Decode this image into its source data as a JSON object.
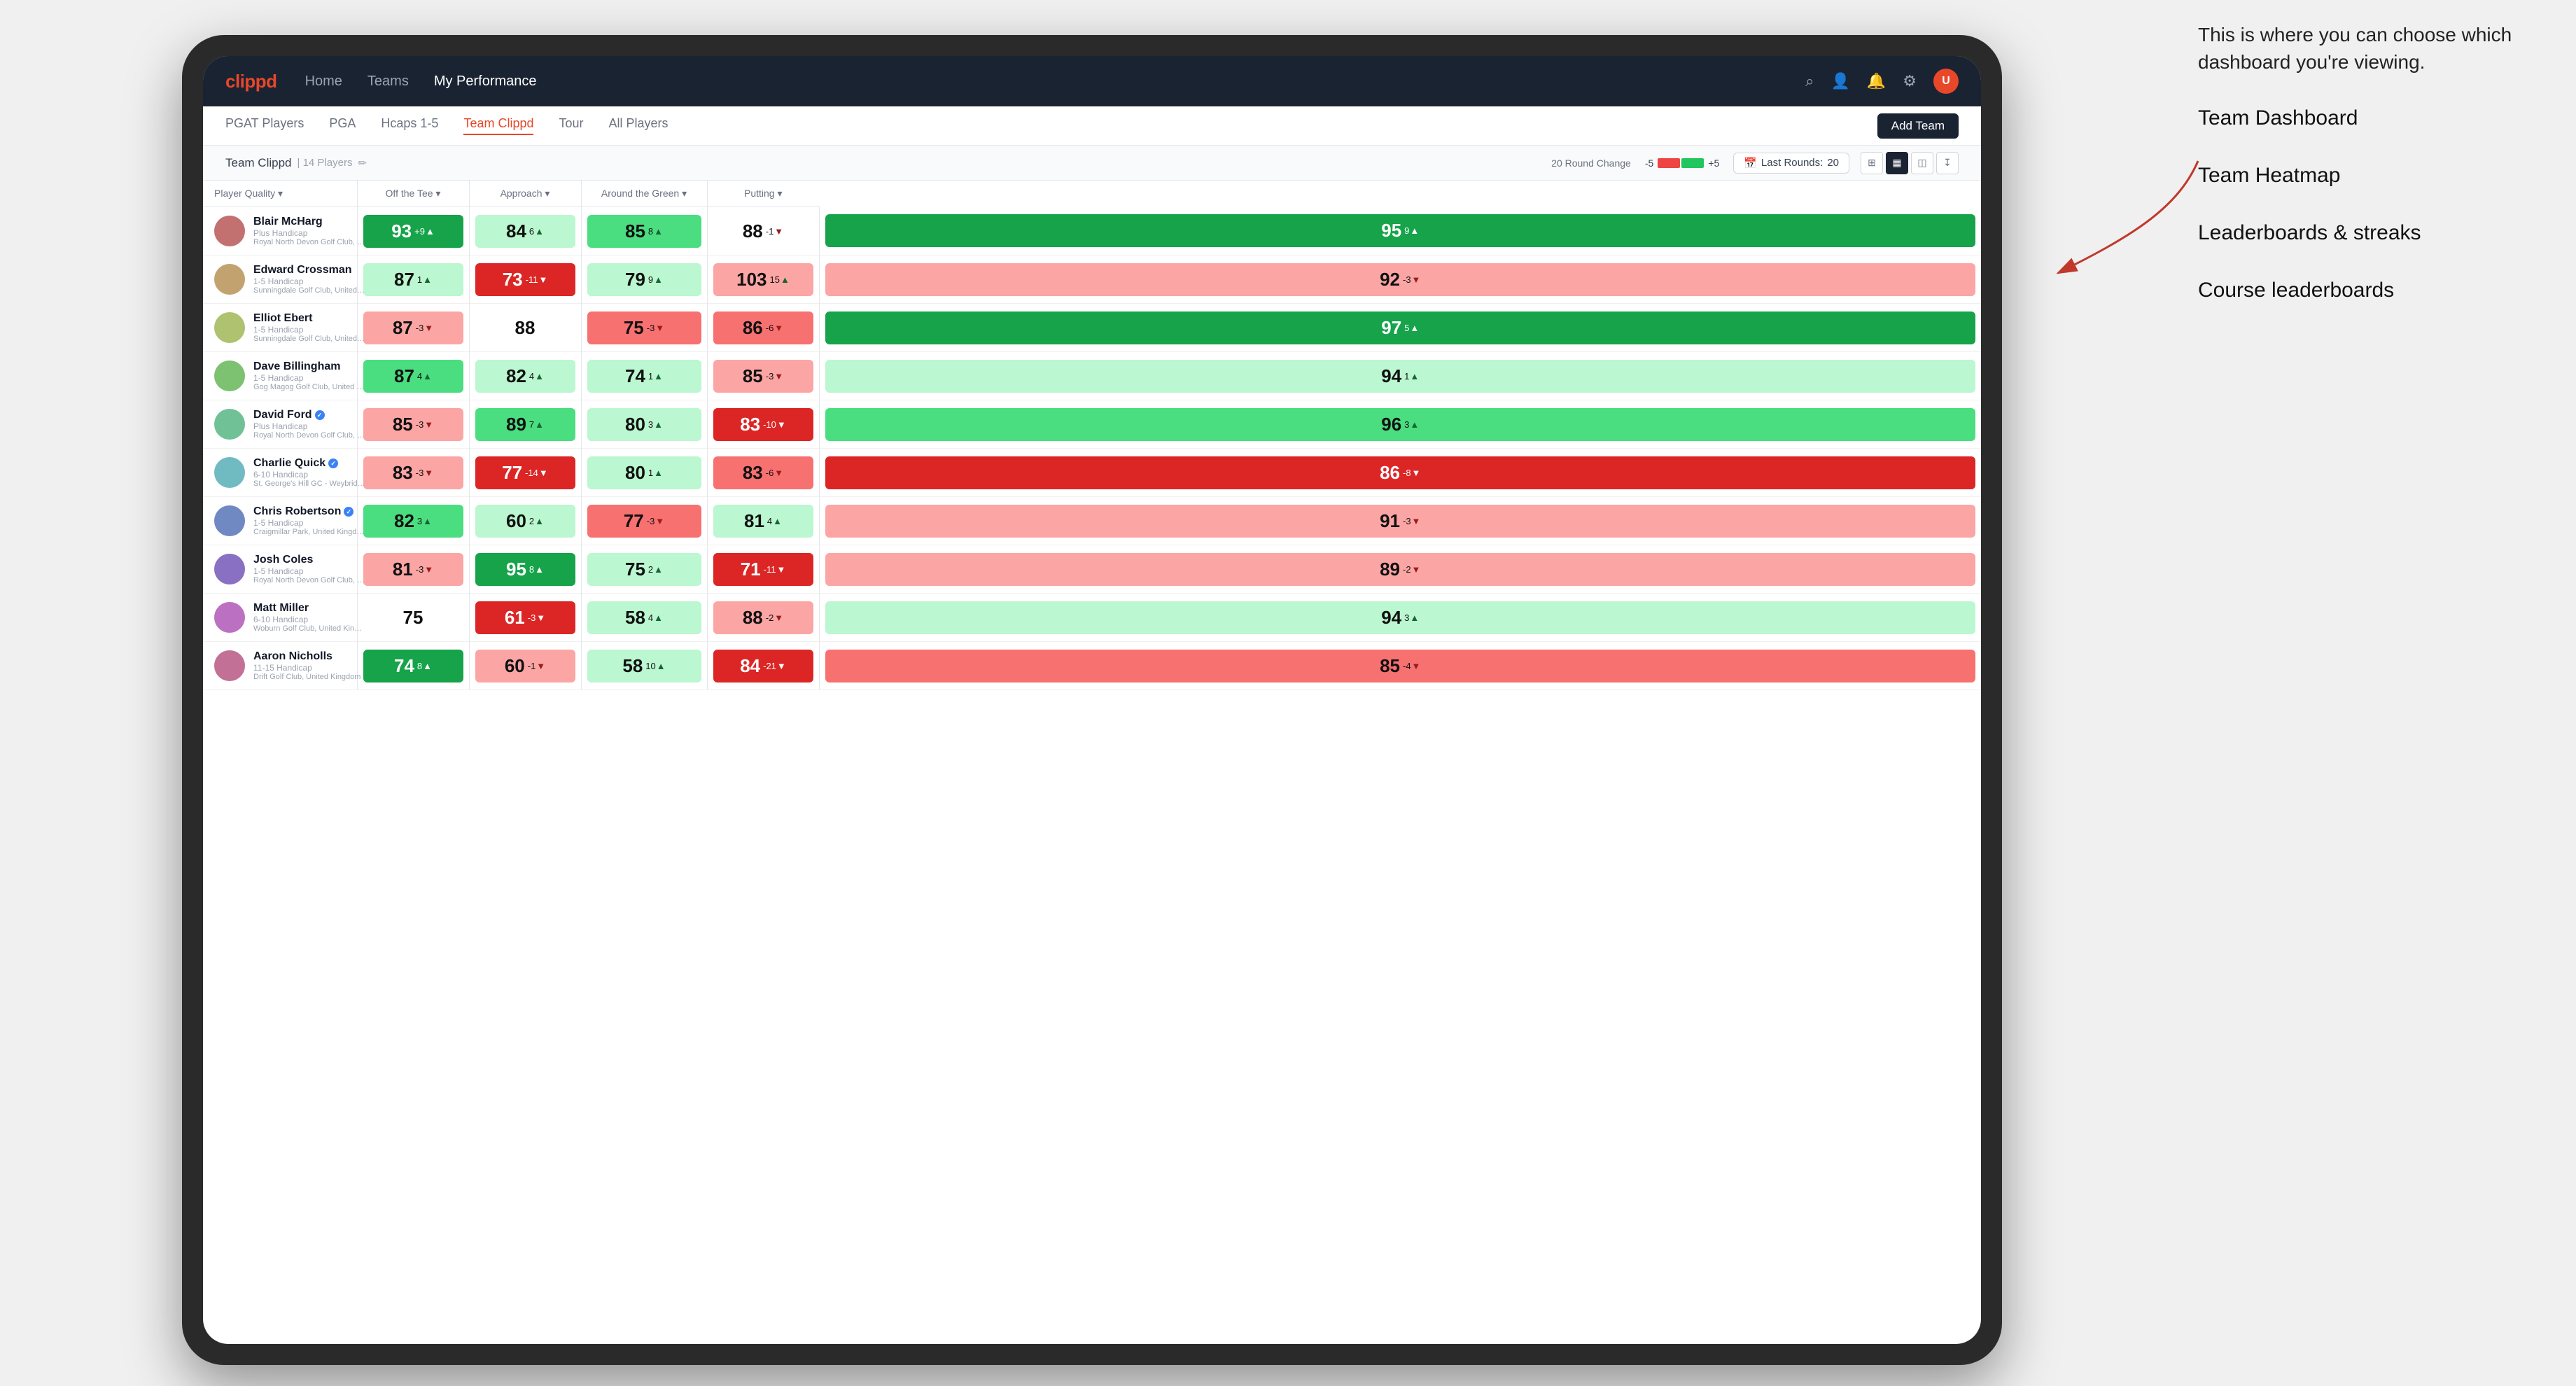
{
  "annotation": {
    "intro": "This is where you can choose which dashboard you're viewing.",
    "items": [
      "Team Dashboard",
      "Team Heatmap",
      "Leaderboards & streaks",
      "Course leaderboards"
    ]
  },
  "nav": {
    "logo": "clippd",
    "links": [
      {
        "label": "Home",
        "active": false
      },
      {
        "label": "Teams",
        "active": false
      },
      {
        "label": "My Performance",
        "active": true
      }
    ],
    "icons": [
      "search",
      "person",
      "bell",
      "settings",
      "avatar"
    ]
  },
  "subnav": {
    "links": [
      {
        "label": "PGAT Players",
        "active": false
      },
      {
        "label": "PGA",
        "active": false
      },
      {
        "label": "Hcaps 1-5",
        "active": false
      },
      {
        "label": "Team Clippd",
        "active": true
      },
      {
        "label": "Tour",
        "active": false
      },
      {
        "label": "All Players",
        "active": false
      }
    ],
    "add_team_label": "Add Team"
  },
  "team_bar": {
    "name": "Team Clippd",
    "separator": "|",
    "count": "14 Players",
    "round_change_label": "20 Round Change",
    "bar_neg": "-5",
    "bar_pos": "+5",
    "last_rounds_label": "Last Rounds:",
    "last_rounds_value": "20",
    "view_options": [
      "grid",
      "table",
      "chart",
      "export"
    ]
  },
  "table": {
    "headers": [
      {
        "label": "Player Quality",
        "sort": true
      },
      {
        "label": "Off the Tee",
        "sort": true
      },
      {
        "label": "Approach",
        "sort": true
      },
      {
        "label": "Around the Green",
        "sort": true
      },
      {
        "label": "Putting",
        "sort": true
      }
    ],
    "players": [
      {
        "name": "Blair McHarg",
        "handicap": "Plus Handicap",
        "club": "Royal North Devon Golf Club, United Kingdom",
        "scores": [
          {
            "value": 93,
            "change": "+9",
            "dir": "up",
            "bg": "green-strong"
          },
          {
            "value": 84,
            "change": "6",
            "dir": "up",
            "bg": "green-light"
          },
          {
            "value": 85,
            "change": "8",
            "dir": "up",
            "bg": "green-medium"
          },
          {
            "value": 88,
            "change": "-1",
            "dir": "down",
            "bg": "white"
          },
          {
            "value": 95,
            "change": "9",
            "dir": "up",
            "bg": "green-strong"
          }
        ]
      },
      {
        "name": "Edward Crossman",
        "handicap": "1-5 Handicap",
        "club": "Sunningdale Golf Club, United Kingdom",
        "scores": [
          {
            "value": 87,
            "change": "1",
            "dir": "up",
            "bg": "green-light"
          },
          {
            "value": 73,
            "change": "-11",
            "dir": "down",
            "bg": "red-strong"
          },
          {
            "value": 79,
            "change": "9",
            "dir": "up",
            "bg": "green-light"
          },
          {
            "value": 103,
            "change": "15",
            "dir": "up",
            "bg": "red-light"
          },
          {
            "value": 92,
            "change": "-3",
            "dir": "down",
            "bg": "red-light"
          }
        ]
      },
      {
        "name": "Elliot Ebert",
        "handicap": "1-5 Handicap",
        "club": "Sunningdale Golf Club, United Kingdom",
        "scores": [
          {
            "value": 87,
            "change": "-3",
            "dir": "down",
            "bg": "red-light"
          },
          {
            "value": 88,
            "change": "",
            "dir": "",
            "bg": "white"
          },
          {
            "value": 75,
            "change": "-3",
            "dir": "down",
            "bg": "red-medium"
          },
          {
            "value": 86,
            "change": "-6",
            "dir": "down",
            "bg": "red-medium"
          },
          {
            "value": 97,
            "change": "5",
            "dir": "up",
            "bg": "green-strong"
          }
        ]
      },
      {
        "name": "Dave Billingham",
        "handicap": "1-5 Handicap",
        "club": "Gog Magog Golf Club, United Kingdom",
        "scores": [
          {
            "value": 87,
            "change": "4",
            "dir": "up",
            "bg": "green-medium"
          },
          {
            "value": 82,
            "change": "4",
            "dir": "up",
            "bg": "green-light"
          },
          {
            "value": 74,
            "change": "1",
            "dir": "up",
            "bg": "green-light"
          },
          {
            "value": 85,
            "change": "-3",
            "dir": "down",
            "bg": "red-light"
          },
          {
            "value": 94,
            "change": "1",
            "dir": "up",
            "bg": "green-light"
          }
        ]
      },
      {
        "name": "David Ford",
        "handicap": "Plus Handicap",
        "club": "Royal North Devon Golf Club, United Kingdom",
        "verified": true,
        "scores": [
          {
            "value": 85,
            "change": "-3",
            "dir": "down",
            "bg": "red-light"
          },
          {
            "value": 89,
            "change": "7",
            "dir": "up",
            "bg": "green-medium"
          },
          {
            "value": 80,
            "change": "3",
            "dir": "up",
            "bg": "green-light"
          },
          {
            "value": 83,
            "change": "-10",
            "dir": "down",
            "bg": "red-strong"
          },
          {
            "value": 96,
            "change": "3",
            "dir": "up",
            "bg": "green-medium"
          }
        ]
      },
      {
        "name": "Charlie Quick",
        "handicap": "6-10 Handicap",
        "club": "St. George's Hill GC - Weybridge - Surrey, Uni...",
        "verified": true,
        "scores": [
          {
            "value": 83,
            "change": "-3",
            "dir": "down",
            "bg": "red-light"
          },
          {
            "value": 77,
            "change": "-14",
            "dir": "down",
            "bg": "red-strong"
          },
          {
            "value": 80,
            "change": "1",
            "dir": "up",
            "bg": "green-light"
          },
          {
            "value": 83,
            "change": "-6",
            "dir": "down",
            "bg": "red-medium"
          },
          {
            "value": 86,
            "change": "-8",
            "dir": "down",
            "bg": "red-strong"
          }
        ]
      },
      {
        "name": "Chris Robertson",
        "handicap": "1-5 Handicap",
        "club": "Craigmillar Park, United Kingdom",
        "verified": true,
        "scores": [
          {
            "value": 82,
            "change": "3",
            "dir": "up",
            "bg": "green-medium"
          },
          {
            "value": 60,
            "change": "2",
            "dir": "up",
            "bg": "green-light"
          },
          {
            "value": 77,
            "change": "-3",
            "dir": "down",
            "bg": "red-medium"
          },
          {
            "value": 81,
            "change": "4",
            "dir": "up",
            "bg": "green-light"
          },
          {
            "value": 91,
            "change": "-3",
            "dir": "down",
            "bg": "red-light"
          }
        ]
      },
      {
        "name": "Josh Coles",
        "handicap": "1-5 Handicap",
        "club": "Royal North Devon Golf Club, United Kingdom",
        "scores": [
          {
            "value": 81,
            "change": "-3",
            "dir": "down",
            "bg": "red-light"
          },
          {
            "value": 95,
            "change": "8",
            "dir": "up",
            "bg": "green-strong"
          },
          {
            "value": 75,
            "change": "2",
            "dir": "up",
            "bg": "green-light"
          },
          {
            "value": 71,
            "change": "-11",
            "dir": "down",
            "bg": "red-strong"
          },
          {
            "value": 89,
            "change": "-2",
            "dir": "down",
            "bg": "red-light"
          }
        ]
      },
      {
        "name": "Matt Miller",
        "handicap": "6-10 Handicap",
        "club": "Woburn Golf Club, United Kingdom",
        "scores": [
          {
            "value": 75,
            "change": "",
            "dir": "",
            "bg": "white"
          },
          {
            "value": 61,
            "change": "-3",
            "dir": "down",
            "bg": "red-strong"
          },
          {
            "value": 58,
            "change": "4",
            "dir": "up",
            "bg": "green-light"
          },
          {
            "value": 88,
            "change": "-2",
            "dir": "down",
            "bg": "red-light"
          },
          {
            "value": 94,
            "change": "3",
            "dir": "up",
            "bg": "green-light"
          }
        ]
      },
      {
        "name": "Aaron Nicholls",
        "handicap": "11-15 Handicap",
        "club": "Drift Golf Club, United Kingdom",
        "scores": [
          {
            "value": 74,
            "change": "8",
            "dir": "up",
            "bg": "green-strong"
          },
          {
            "value": 60,
            "change": "-1",
            "dir": "down",
            "bg": "red-light"
          },
          {
            "value": 58,
            "change": "10",
            "dir": "up",
            "bg": "green-light"
          },
          {
            "value": 84,
            "change": "-21",
            "dir": "down",
            "bg": "red-strong"
          },
          {
            "value": 85,
            "change": "-4",
            "dir": "down",
            "bg": "red-medium"
          }
        ]
      }
    ]
  },
  "colors": {
    "green_strong": "#16a34a",
    "green_medium": "#4ade80",
    "green_light": "#bbf7d0",
    "white": "#ffffff",
    "red_light": "#fca5a5",
    "red_medium": "#f87171",
    "red_strong": "#dc2626",
    "nav_bg": "#1a2332",
    "accent": "#e8472a"
  }
}
